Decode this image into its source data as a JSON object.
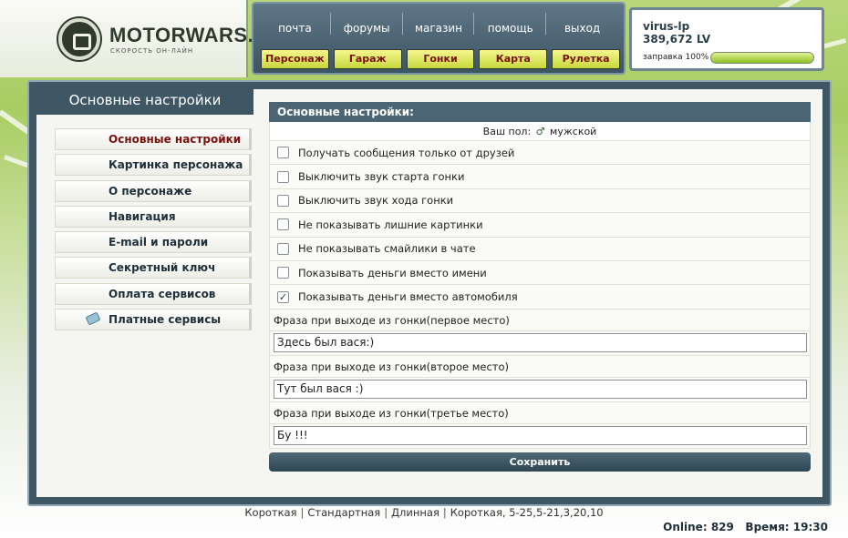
{
  "logo": {
    "title": "MOTORWARS.RU",
    "subtitle": "СКОРОСТЬ ОН-ЛАЙН"
  },
  "nav": {
    "top": [
      "почта",
      "форумы",
      "магазин",
      "помощь",
      "выход"
    ],
    "bottom": [
      "Персонаж",
      "Гараж",
      "Гонки",
      "Карта",
      "Рулетка"
    ]
  },
  "user": {
    "name": "virus-lp",
    "money": "389,672 LV",
    "fuel_label": "заправка 100%",
    "fuel_percent": 100
  },
  "sidebar": {
    "title": "Основные настройки",
    "items": [
      {
        "label": "Основные настройки",
        "active": true
      },
      {
        "label": "Картинка персонажа",
        "active": false
      },
      {
        "label": "О персонаже",
        "active": false
      },
      {
        "label": "Навигация",
        "active": false
      },
      {
        "label": "E-mail и пароли",
        "active": false
      },
      {
        "label": "Секретный ключ",
        "active": false
      },
      {
        "label": "Оплата сервисов",
        "active": false
      },
      {
        "label": "Платные сервисы",
        "active": false,
        "icon": "ticket-icon"
      }
    ]
  },
  "settings": {
    "header": "Основные настройки:",
    "gender_label": "Ваш пол:",
    "gender_value": "мужской",
    "options": [
      {
        "label": "Получать сообщения только от друзей",
        "checked": false
      },
      {
        "label": "Выключить звук старта гонки",
        "checked": false
      },
      {
        "label": "Выключить звук хода гонки",
        "checked": false
      },
      {
        "label": "Не показывать лишние картинки",
        "checked": false
      },
      {
        "label": "Не показывать смайлики в чате",
        "checked": false
      },
      {
        "label": "Показывать деньги вместо имени",
        "checked": false
      },
      {
        "label": "Показывать деньги вместо автомобиля",
        "checked": true
      }
    ],
    "phrases": [
      {
        "label": "Фраза при выходе из гонки(первое место)",
        "value": "Здесь был вася:)"
      },
      {
        "label": "Фраза при выходе из гонки(второе место)",
        "value": "Тут был вася :)"
      },
      {
        "label": "Фраза при выходе из гонки(третье место)",
        "value": "Бу !!!"
      }
    ],
    "save_label": "Сохранить"
  },
  "footer": {
    "links": [
      "Короткая",
      "Стандартная",
      "Длинная",
      "Короткая, 5-25,5-21,3,20,10"
    ],
    "online_label": "Online:",
    "online_count": "829",
    "time_label": "Время:",
    "time_value": "19:30"
  }
}
